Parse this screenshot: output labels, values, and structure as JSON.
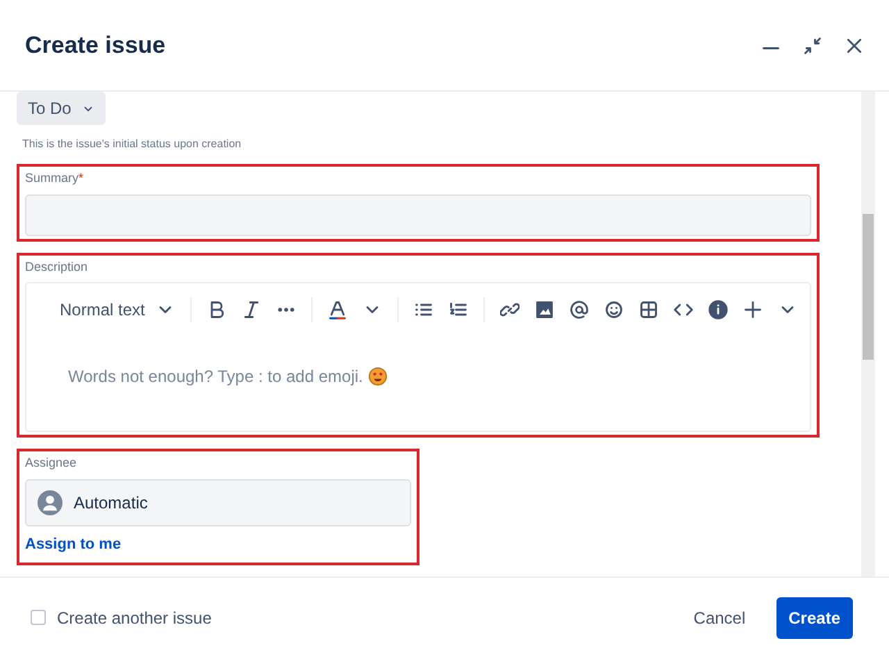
{
  "dialog": {
    "title": "Create issue"
  },
  "status": {
    "value": "To Do",
    "hint": "This is the issue's initial status upon creation"
  },
  "summary": {
    "label": "Summary",
    "required_mark": "*",
    "highlighted": true
  },
  "description": {
    "label": "Description",
    "highlighted": true,
    "text_style": "Normal text",
    "placeholder": "Words not enough? Type : to add emoji."
  },
  "assignee": {
    "label": "Assignee",
    "highlighted": true,
    "value": "Automatic",
    "link": "Assign to me"
  },
  "footer": {
    "create_another": {
      "label": "Create another issue",
      "checked": false
    },
    "buttons": [
      {
        "label": "Cancel",
        "kind": "subtle"
      },
      {
        "label": "Create",
        "kind": "primary"
      }
    ]
  }
}
